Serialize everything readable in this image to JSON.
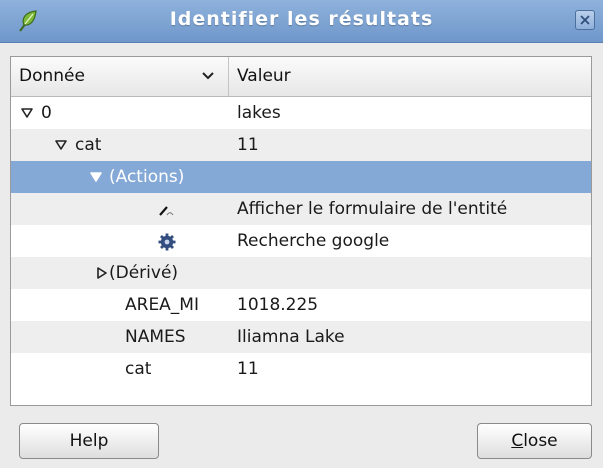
{
  "window": {
    "title": "Identifier les résultats"
  },
  "tree": {
    "columns": [
      "Donnée",
      "Valeur"
    ],
    "rows": [
      {
        "label": "0",
        "value": "lakes"
      },
      {
        "label": "cat",
        "value": "11"
      },
      {
        "label": "(Actions)",
        "value": ""
      },
      {
        "label": "",
        "value": "Afficher le formulaire de l'entité"
      },
      {
        "label": "",
        "value": "Recherche google"
      },
      {
        "label": "(Dérivé)",
        "value": ""
      },
      {
        "label": "AREA_MI",
        "value": "1018.225"
      },
      {
        "label": "NAMES",
        "value": "Iliamna Lake"
      },
      {
        "label": "cat",
        "value": "11"
      }
    ]
  },
  "buttons": {
    "help": "Help",
    "close_mnemonic": "C",
    "close_rest": "lose"
  },
  "icons": {
    "app": "qgis-leaf-icon",
    "close": "close-icon",
    "form": "edit-form-icon",
    "action": "gear-icon"
  },
  "colors": {
    "titlebar": "#7aa0d0",
    "selection": "#85a9d6"
  }
}
